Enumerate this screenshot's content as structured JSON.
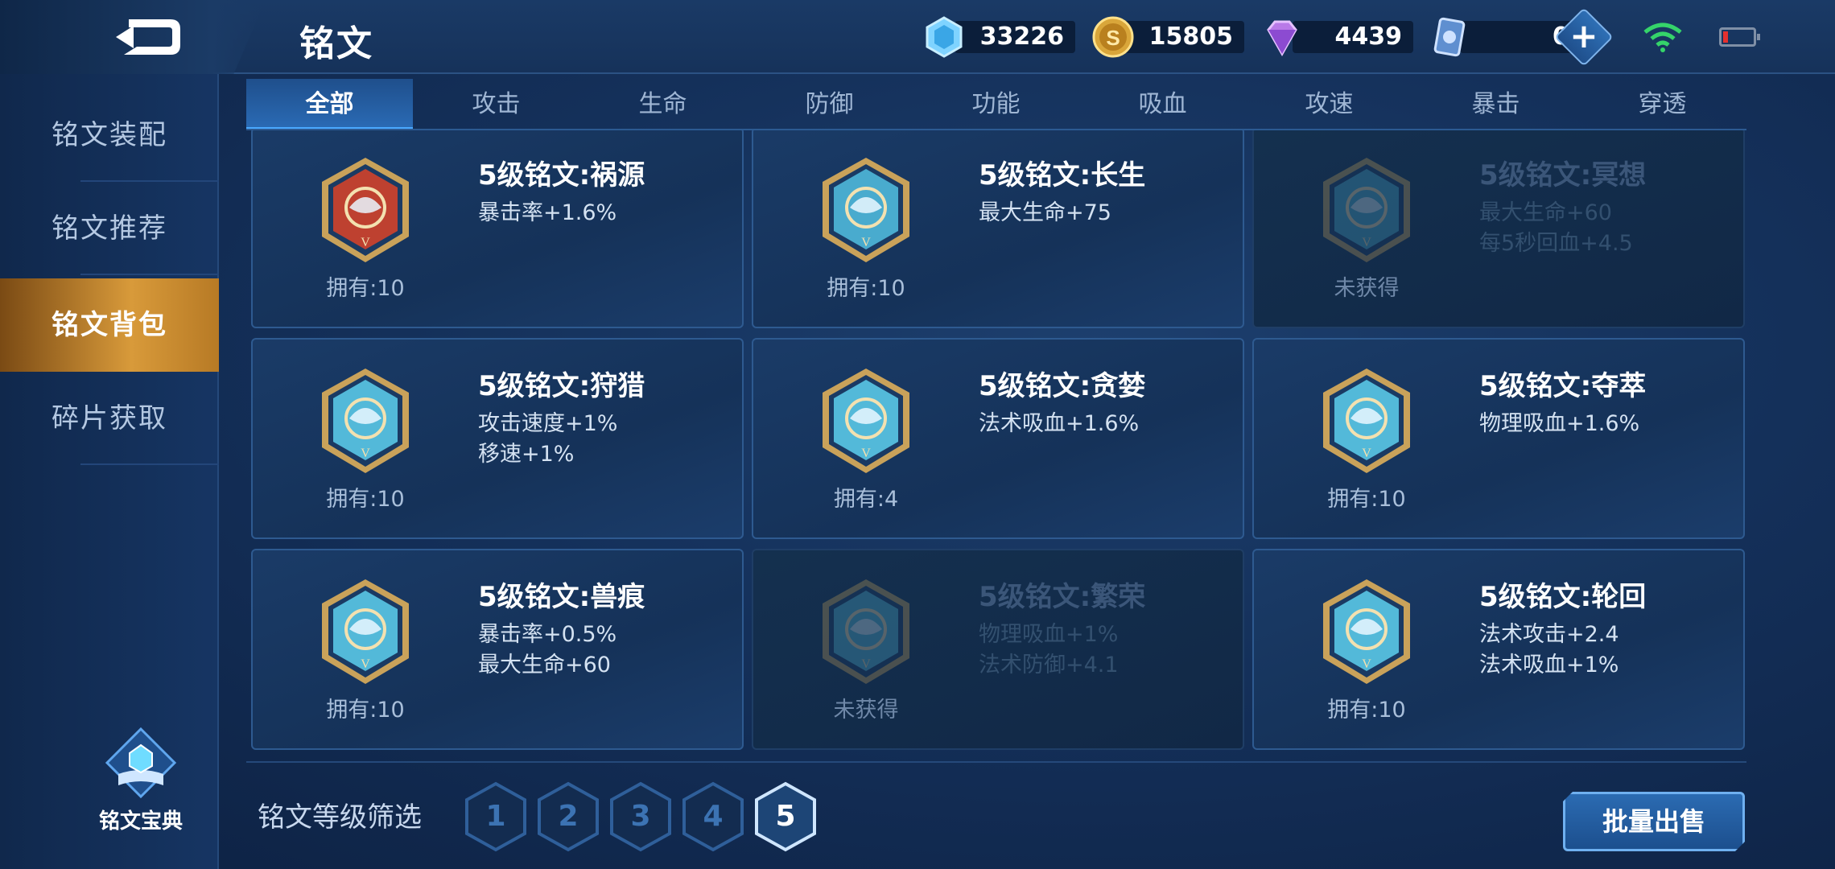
{
  "header": {
    "title": "铭文",
    "currencies": [
      {
        "icon": "diamond-icon",
        "value": "33226"
      },
      {
        "icon": "gold-coin-icon",
        "value": "15805"
      },
      {
        "icon": "purple-gem-icon",
        "value": "4439"
      },
      {
        "icon": "card-icon",
        "value": "0"
      }
    ],
    "plus_label": "+"
  },
  "sidebar": {
    "items": [
      {
        "label": "铭文装配"
      },
      {
        "label": "铭文推荐"
      },
      {
        "label": "铭文背包"
      },
      {
        "label": "碎片获取"
      }
    ],
    "active_index": 2,
    "codex_label": "铭文宝典"
  },
  "tabs": [
    "全部",
    "攻击",
    "生命",
    "防御",
    "功能",
    "吸血",
    "攻速",
    "暴击",
    "穿透"
  ],
  "active_tab": 0,
  "cards": [
    {
      "name": "5级铭文:祸源",
      "stats": [
        "暴击率+1.6%"
      ],
      "owned": "拥有:10",
      "locked": false,
      "color": "#d0432a"
    },
    {
      "name": "5级铭文:长生",
      "stats": [
        "最大生命+75"
      ],
      "owned": "拥有:10",
      "locked": false,
      "color": "#4fb8d9"
    },
    {
      "name": "5级铭文:冥想",
      "stats": [
        "最大生命+60",
        "每5秒回血+4.5"
      ],
      "owned": "未获得",
      "locked": true,
      "color": "#4fb8d9"
    },
    {
      "name": "5级铭文:狩猎",
      "stats": [
        "攻击速度+1%",
        "移速+1%"
      ],
      "owned": "拥有:10",
      "locked": false,
      "color": "#5ac8e6"
    },
    {
      "name": "5级铭文:贪婪",
      "stats": [
        "法术吸血+1.6%"
      ],
      "owned": "拥有:4",
      "locked": false,
      "color": "#5ac8e6"
    },
    {
      "name": "5级铭文:夺萃",
      "stats": [
        "物理吸血+1.6%"
      ],
      "owned": "拥有:10",
      "locked": false,
      "color": "#5ac8e6"
    },
    {
      "name": "5级铭文:兽痕",
      "stats": [
        "暴击率+0.5%",
        "最大生命+60"
      ],
      "owned": "拥有:10",
      "locked": false,
      "color": "#5ac8e6"
    },
    {
      "name": "5级铭文:繁荣",
      "stats": [
        "物理吸血+1%",
        "法术防御+4.1"
      ],
      "owned": "未获得",
      "locked": true,
      "color": "#5ac8e6"
    },
    {
      "name": "5级铭文:轮回",
      "stats": [
        "法术攻击+2.4",
        "法术吸血+1%"
      ],
      "owned": "拥有:10",
      "locked": false,
      "color": "#5ac8e6"
    }
  ],
  "filter": {
    "label": "铭文等级筛选",
    "levels": [
      "1",
      "2",
      "3",
      "4",
      "5"
    ],
    "active_level": "5"
  },
  "sell_button": "批量出售"
}
